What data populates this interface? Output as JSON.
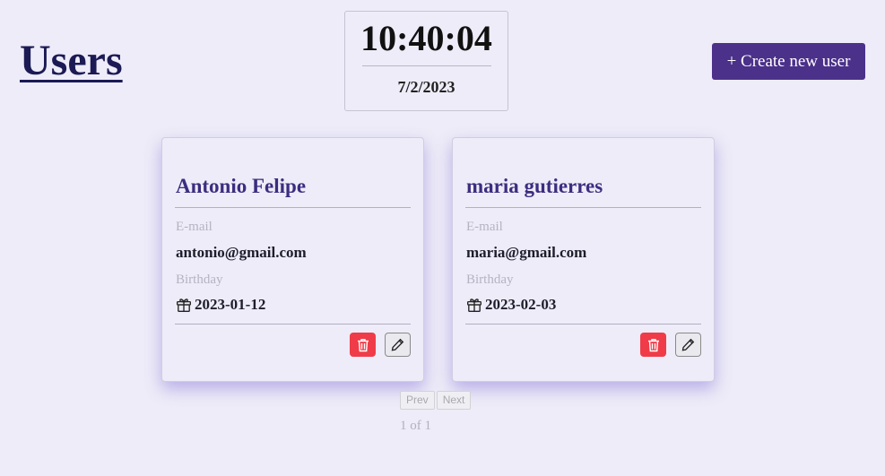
{
  "header": {
    "title": "Users",
    "create_button_label": "+ Create new user"
  },
  "clock": {
    "time": "10:40:04",
    "date": "7/2/2023"
  },
  "users": [
    {
      "name": "Antonio Felipe",
      "email_label": "E-mail",
      "email": "antonio@gmail.com",
      "birthday_label": "Birthday",
      "birthday": "2023-01-12"
    },
    {
      "name": "maria gutierres",
      "email_label": "E-mail",
      "email": "maria@gmail.com",
      "birthday_label": "Birthday",
      "birthday": "2023-02-03"
    }
  ],
  "pagination": {
    "prev_label": "Prev",
    "next_label": "Next",
    "page_indicator": "1 of 1"
  },
  "icons": {
    "birthday": "gift-icon",
    "delete": "trash-icon",
    "edit": "pencil-icon"
  },
  "colors": {
    "background": "#eeecf8",
    "title": "#1b1a55",
    "primary_button": "#4b3189",
    "card_name": "#3c2d80",
    "delete_button": "#ef3c48",
    "label": "#b5b3c3"
  }
}
